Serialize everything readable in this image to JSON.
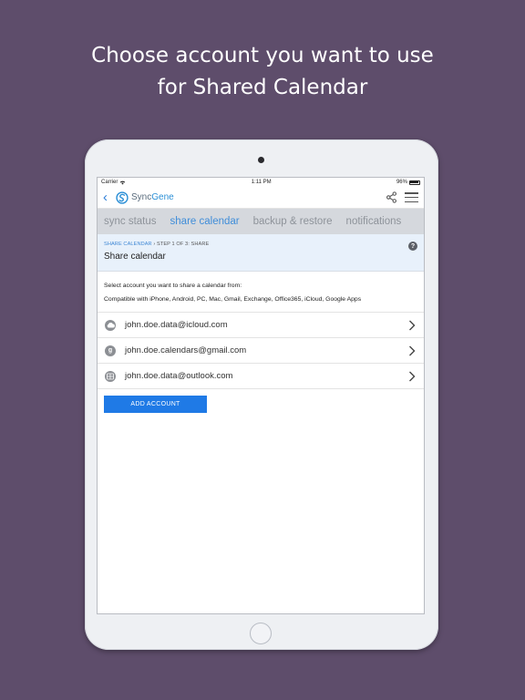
{
  "headline": {
    "line1": "Choose account you want to use",
    "line2": "for Shared Calendar"
  },
  "statusbar": {
    "carrier": "Carrier",
    "time": "1:11 PM",
    "battery": "96%"
  },
  "appbar": {
    "logo_prefix": "Sync",
    "logo_suffix": "Gene"
  },
  "tabs": [
    {
      "label": "sync status",
      "active": false
    },
    {
      "label": "share calendar",
      "active": true
    },
    {
      "label": "backup & restore",
      "active": false
    },
    {
      "label": "notifications",
      "active": false
    }
  ],
  "step": {
    "breadcrumb_link": "SHARE CALENDAR",
    "breadcrumb_sep": "›",
    "breadcrumb_step": "STEP 1 OF 3: SHARE",
    "title": "Share calendar",
    "help": "?"
  },
  "description": {
    "line1": "Select account you want to share a calendar from:",
    "line2": "Compatible with iPhone, Android, PC, Mac, Gmail, Exchange, Office365, iCloud, Google Apps"
  },
  "accounts": [
    {
      "email": "john.doe.data@icloud.com",
      "icon": "icloud-icon"
    },
    {
      "email": "john.doe.calendars@gmail.com",
      "icon": "google-icon"
    },
    {
      "email": "john.doe.data@outlook.com",
      "icon": "outlook-icon"
    }
  ],
  "add_account_label": "ADD ACCOUNT",
  "colors": {
    "background": "#5e4d6b",
    "accent": "#1f7ae6",
    "active_tab": "#3f8dd9"
  }
}
